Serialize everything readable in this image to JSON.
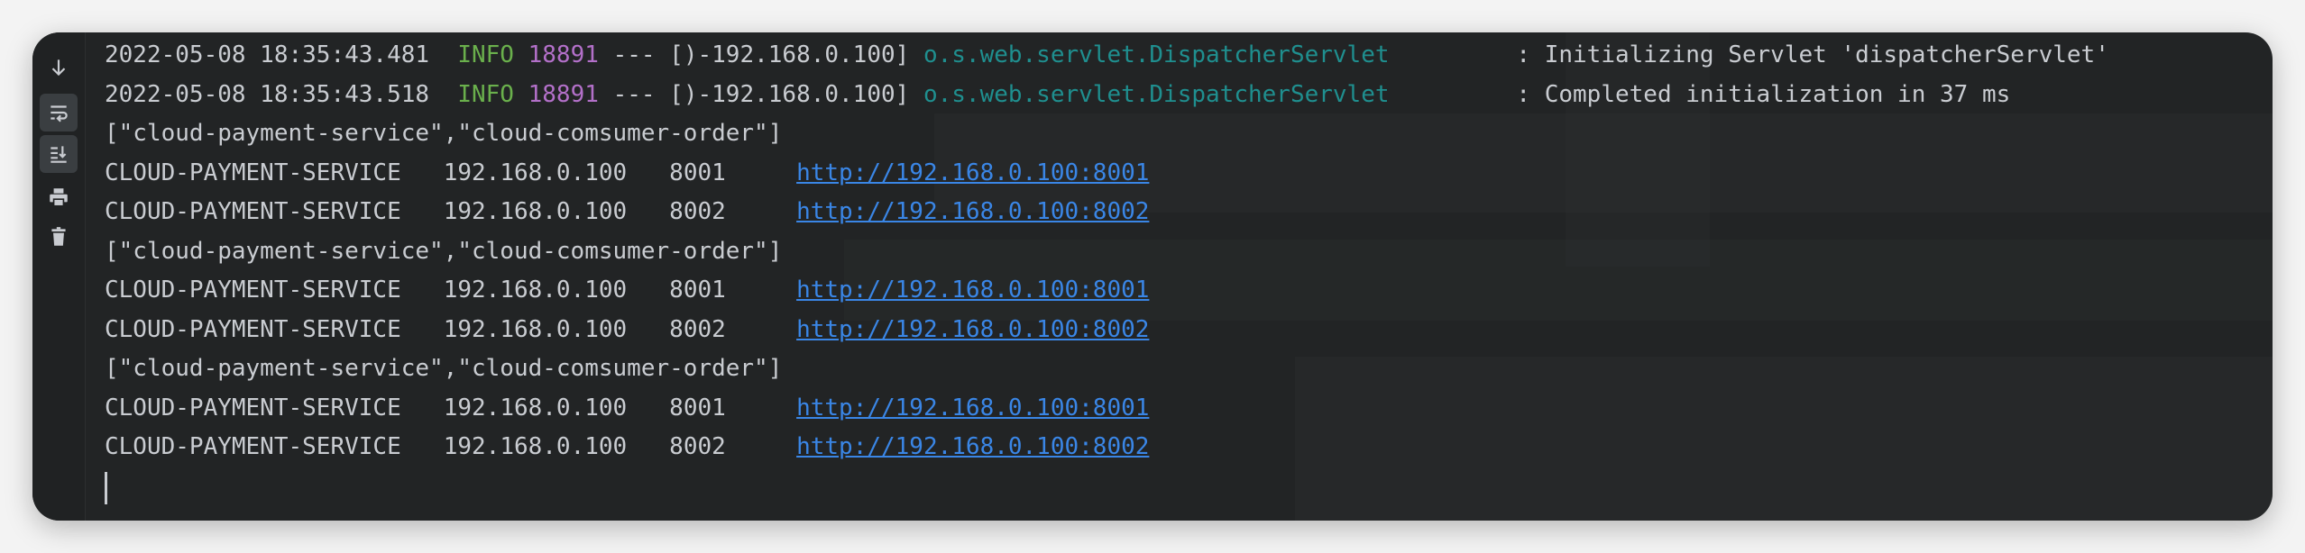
{
  "toolbar": {
    "icons": [
      "scroll-down-icon",
      "soft-wrap-icon",
      "scroll-to-end-icon",
      "print-icon",
      "trash-icon"
    ]
  },
  "log_lines": [
    {
      "date": "2022-05-08 18:35:43.481",
      "level": "INFO",
      "pid": "18891",
      "sep": "---",
      "thread": "[)-192.168.0.100]",
      "logger": "o.s.web.servlet.DispatcherServlet",
      "message": ": Initializing Servlet 'dispatcherServlet'"
    },
    {
      "date": "2022-05-08 18:35:43.518",
      "level": "INFO",
      "pid": "18891",
      "sep": "---",
      "thread": "[)-192.168.0.100]",
      "logger": "o.s.web.servlet.DispatcherServlet",
      "message": ": Completed initialization in 37 ms"
    }
  ],
  "service_list_text": "[\"cloud-payment-service\",\"cloud-comsumer-order\"]",
  "instance_groups": [
    [
      {
        "service": "CLOUD-PAYMENT-SERVICE",
        "host": "192.168.0.100",
        "port": "8001",
        "url": "http://192.168.0.100:8001"
      },
      {
        "service": "CLOUD-PAYMENT-SERVICE",
        "host": "192.168.0.100",
        "port": "8002",
        "url": "http://192.168.0.100:8002"
      }
    ],
    [
      {
        "service": "CLOUD-PAYMENT-SERVICE",
        "host": "192.168.0.100",
        "port": "8001",
        "url": "http://192.168.0.100:8001"
      },
      {
        "service": "CLOUD-PAYMENT-SERVICE",
        "host": "192.168.0.100",
        "port": "8002",
        "url": "http://192.168.0.100:8002"
      }
    ],
    [
      {
        "service": "CLOUD-PAYMENT-SERVICE",
        "host": "192.168.0.100",
        "port": "8001",
        "url": "http://192.168.0.100:8001"
      },
      {
        "service": "CLOUD-PAYMENT-SERVICE",
        "host": "192.168.0.100",
        "port": "8002",
        "url": "http://192.168.0.100:8002"
      }
    ]
  ],
  "colors": {
    "background": "#222425",
    "text": "#c9ccd1",
    "info": "#6ab04c",
    "pid": "#b370c9",
    "logger": "#1f8f8f",
    "link": "#3a86e6"
  }
}
